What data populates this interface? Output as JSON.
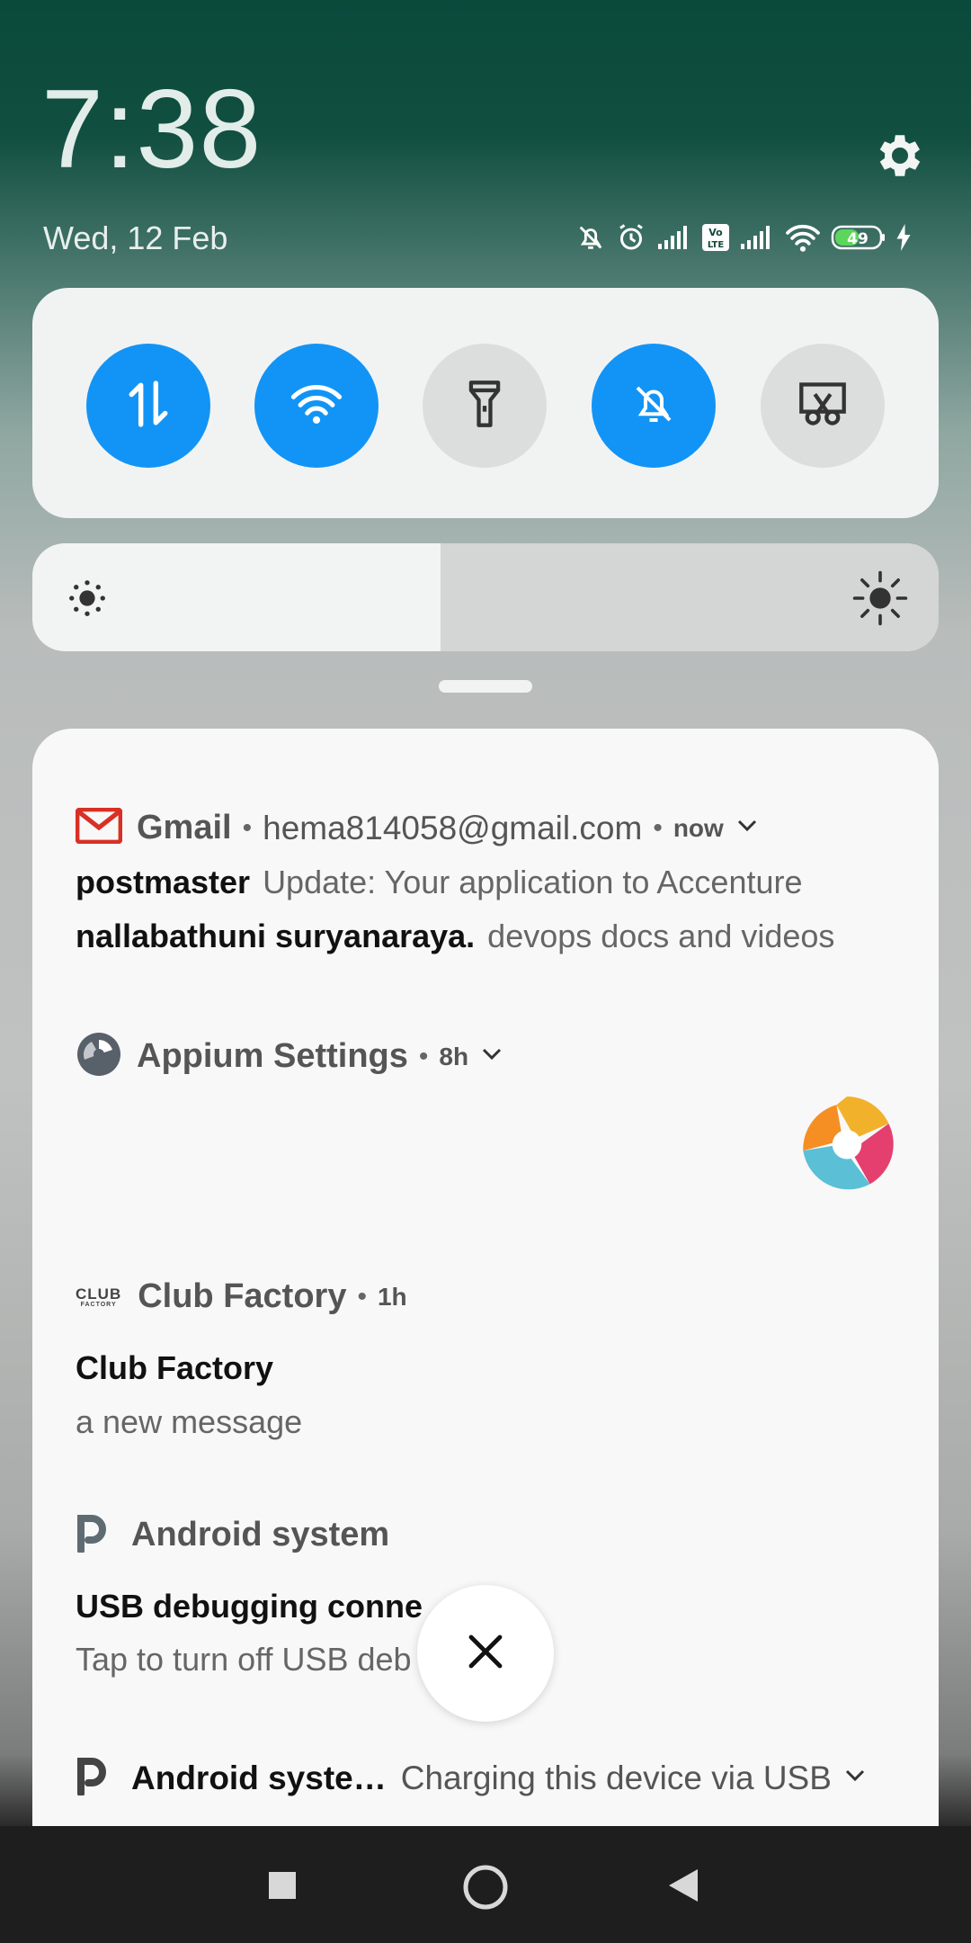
{
  "status": {
    "time": "7:38",
    "date": "Wed, 12 Feb",
    "battery": "49",
    "icons": [
      "muted-bell-icon",
      "alarm-icon",
      "signal-icon",
      "volte-icon",
      "signal-icon",
      "wifi-icon",
      "battery-icon",
      "charging-icon"
    ]
  },
  "quick_settings": {
    "toggles": [
      {
        "name": "mobile-data",
        "icon": "data-arrows-icon",
        "on": true
      },
      {
        "name": "wifi",
        "icon": "wifi-icon",
        "on": true
      },
      {
        "name": "flashlight",
        "icon": "flashlight-icon",
        "on": false
      },
      {
        "name": "silent",
        "icon": "muted-bell-icon",
        "on": true
      },
      {
        "name": "screenshot",
        "icon": "scissors-icon",
        "on": false
      }
    ],
    "brightness_level": 0.45
  },
  "notifications": {
    "gmail": {
      "app": "Gmail",
      "account": "hema814058@gmail.com",
      "time": "now",
      "lines": [
        {
          "sender": "postmaster",
          "text": "Update: Your application to Accenture"
        },
        {
          "sender": "nallabathuni suryanaraya.",
          "text": "devops docs and videos"
        }
      ]
    },
    "appium": {
      "app": "Appium Settings",
      "time": "8h"
    },
    "clubfactory": {
      "app": "Club Factory",
      "logo_text_top": "CLUB",
      "logo_text_bottom": "FACTORY",
      "time": "1h",
      "title": "Club Factory",
      "body": "a new message"
    },
    "android1": {
      "app": "Android system",
      "title": "USB debugging conne",
      "body": "Tap to turn off USB deb"
    },
    "android2": {
      "app": "Android syste…",
      "text": "Charging this device via USB"
    }
  },
  "colors": {
    "accent": "#1294f6",
    "gmail_red": "#d93025"
  }
}
